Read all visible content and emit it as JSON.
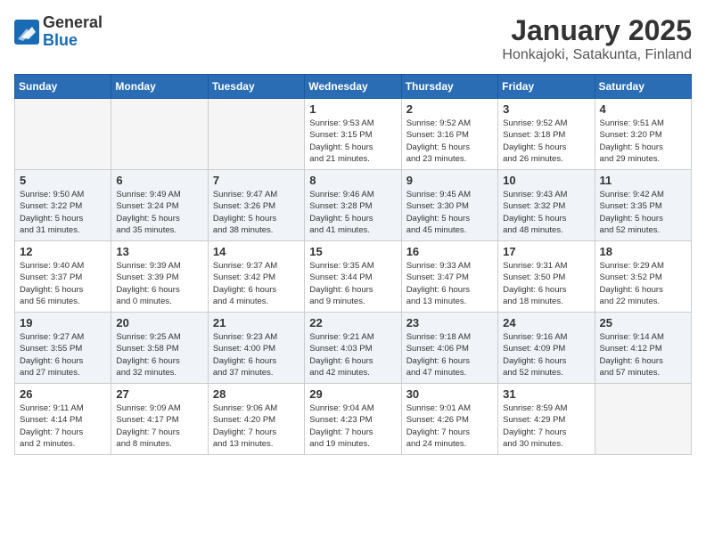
{
  "header": {
    "logo_general": "General",
    "logo_blue": "Blue",
    "title": "January 2025",
    "subtitle": "Honkajoki, Satakunta, Finland"
  },
  "days_of_week": [
    "Sunday",
    "Monday",
    "Tuesday",
    "Wednesday",
    "Thursday",
    "Friday",
    "Saturday"
  ],
  "weeks": [
    [
      {
        "day": "",
        "info": ""
      },
      {
        "day": "",
        "info": ""
      },
      {
        "day": "",
        "info": ""
      },
      {
        "day": "1",
        "info": "Sunrise: 9:53 AM\nSunset: 3:15 PM\nDaylight: 5 hours\nand 21 minutes."
      },
      {
        "day": "2",
        "info": "Sunrise: 9:52 AM\nSunset: 3:16 PM\nDaylight: 5 hours\nand 23 minutes."
      },
      {
        "day": "3",
        "info": "Sunrise: 9:52 AM\nSunset: 3:18 PM\nDaylight: 5 hours\nand 26 minutes."
      },
      {
        "day": "4",
        "info": "Sunrise: 9:51 AM\nSunset: 3:20 PM\nDaylight: 5 hours\nand 29 minutes."
      }
    ],
    [
      {
        "day": "5",
        "info": "Sunrise: 9:50 AM\nSunset: 3:22 PM\nDaylight: 5 hours\nand 31 minutes."
      },
      {
        "day": "6",
        "info": "Sunrise: 9:49 AM\nSunset: 3:24 PM\nDaylight: 5 hours\nand 35 minutes."
      },
      {
        "day": "7",
        "info": "Sunrise: 9:47 AM\nSunset: 3:26 PM\nDaylight: 5 hours\nand 38 minutes."
      },
      {
        "day": "8",
        "info": "Sunrise: 9:46 AM\nSunset: 3:28 PM\nDaylight: 5 hours\nand 41 minutes."
      },
      {
        "day": "9",
        "info": "Sunrise: 9:45 AM\nSunset: 3:30 PM\nDaylight: 5 hours\nand 45 minutes."
      },
      {
        "day": "10",
        "info": "Sunrise: 9:43 AM\nSunset: 3:32 PM\nDaylight: 5 hours\nand 48 minutes."
      },
      {
        "day": "11",
        "info": "Sunrise: 9:42 AM\nSunset: 3:35 PM\nDaylight: 5 hours\nand 52 minutes."
      }
    ],
    [
      {
        "day": "12",
        "info": "Sunrise: 9:40 AM\nSunset: 3:37 PM\nDaylight: 5 hours\nand 56 minutes."
      },
      {
        "day": "13",
        "info": "Sunrise: 9:39 AM\nSunset: 3:39 PM\nDaylight: 6 hours\nand 0 minutes."
      },
      {
        "day": "14",
        "info": "Sunrise: 9:37 AM\nSunset: 3:42 PM\nDaylight: 6 hours\nand 4 minutes."
      },
      {
        "day": "15",
        "info": "Sunrise: 9:35 AM\nSunset: 3:44 PM\nDaylight: 6 hours\nand 9 minutes."
      },
      {
        "day": "16",
        "info": "Sunrise: 9:33 AM\nSunset: 3:47 PM\nDaylight: 6 hours\nand 13 minutes."
      },
      {
        "day": "17",
        "info": "Sunrise: 9:31 AM\nSunset: 3:50 PM\nDaylight: 6 hours\nand 18 minutes."
      },
      {
        "day": "18",
        "info": "Sunrise: 9:29 AM\nSunset: 3:52 PM\nDaylight: 6 hours\nand 22 minutes."
      }
    ],
    [
      {
        "day": "19",
        "info": "Sunrise: 9:27 AM\nSunset: 3:55 PM\nDaylight: 6 hours\nand 27 minutes."
      },
      {
        "day": "20",
        "info": "Sunrise: 9:25 AM\nSunset: 3:58 PM\nDaylight: 6 hours\nand 32 minutes."
      },
      {
        "day": "21",
        "info": "Sunrise: 9:23 AM\nSunset: 4:00 PM\nDaylight: 6 hours\nand 37 minutes."
      },
      {
        "day": "22",
        "info": "Sunrise: 9:21 AM\nSunset: 4:03 PM\nDaylight: 6 hours\nand 42 minutes."
      },
      {
        "day": "23",
        "info": "Sunrise: 9:18 AM\nSunset: 4:06 PM\nDaylight: 6 hours\nand 47 minutes."
      },
      {
        "day": "24",
        "info": "Sunrise: 9:16 AM\nSunset: 4:09 PM\nDaylight: 6 hours\nand 52 minutes."
      },
      {
        "day": "25",
        "info": "Sunrise: 9:14 AM\nSunset: 4:12 PM\nDaylight: 6 hours\nand 57 minutes."
      }
    ],
    [
      {
        "day": "26",
        "info": "Sunrise: 9:11 AM\nSunset: 4:14 PM\nDaylight: 7 hours\nand 2 minutes."
      },
      {
        "day": "27",
        "info": "Sunrise: 9:09 AM\nSunset: 4:17 PM\nDaylight: 7 hours\nand 8 minutes."
      },
      {
        "day": "28",
        "info": "Sunrise: 9:06 AM\nSunset: 4:20 PM\nDaylight: 7 hours\nand 13 minutes."
      },
      {
        "day": "29",
        "info": "Sunrise: 9:04 AM\nSunset: 4:23 PM\nDaylight: 7 hours\nand 19 minutes."
      },
      {
        "day": "30",
        "info": "Sunrise: 9:01 AM\nSunset: 4:26 PM\nDaylight: 7 hours\nand 24 minutes."
      },
      {
        "day": "31",
        "info": "Sunrise: 8:59 AM\nSunset: 4:29 PM\nDaylight: 7 hours\nand 30 minutes."
      },
      {
        "day": "",
        "info": ""
      }
    ]
  ]
}
